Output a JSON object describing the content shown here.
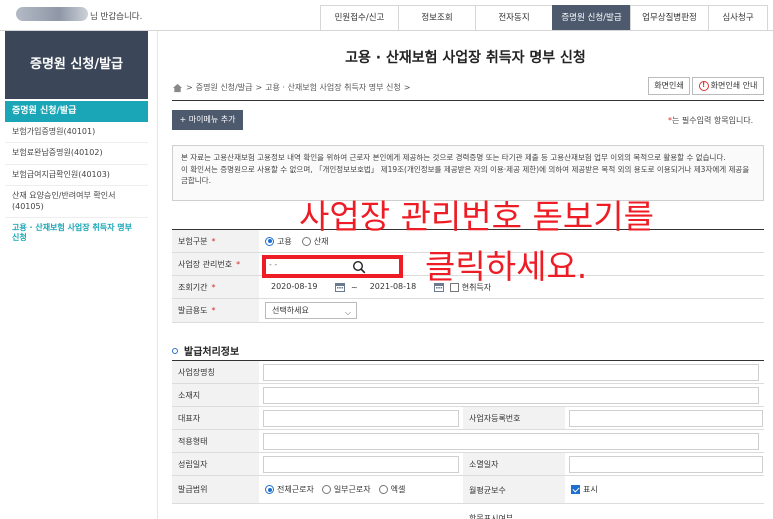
{
  "header": {
    "greeting": "님 반갑습니다.",
    "nav": [
      {
        "label": "민원접수/신고",
        "active": false
      },
      {
        "label": "정보조회",
        "active": false
      },
      {
        "label": "전자동지",
        "active": false
      },
      {
        "label": "증명원 신청/발급",
        "active": true
      },
      {
        "label": "업무상질병판정",
        "active": false
      },
      {
        "label": "심사청구",
        "active": false
      }
    ]
  },
  "sidebar": {
    "title": "증명원 신청/발급",
    "section": "증명원 신청/발급",
    "items": [
      {
        "label": "보험가입증명원(40101)"
      },
      {
        "label": "보험료완납증명원(40102)"
      },
      {
        "label": "보험급여지급확인원(40103)"
      },
      {
        "label": "산재 요양승인/반려여부 확인서(40105)"
      },
      {
        "label": "고용 · 산재보험 사업장 취득자 명부 신청"
      }
    ]
  },
  "main": {
    "title": "고용 · 산재보험 사업장 취득자 명부 신청",
    "breadcrumb": [
      "증명원 신청/발급",
      "고용 · 산재보험 사업장 취득자 명부 신청"
    ],
    "print_label": "화면인쇄",
    "guide_label": "화면인쇄 안내",
    "mymenu_label": "+ 마이메뉴 추가",
    "required_note": "는 필수입력 항목입니다.",
    "notice_line1": "본 자료는 고용산재보험 고용정보 내역 확인을 위하여 근로자 본인에게 제공하는 것으로 경력증명 또는 타기관 제출 등 고용산재보험 업무 이외의 목적으로 활용할 수 없습니다.",
    "notice_line2": "이 확인서는 증명원으로 사용할 수 없으며, 「개인정보보호법」 제19조(개인정보를 제공받은 자의 이용·제공 제한)에 의하여 제공받은 목적 외의 용도로 이용되거나 제3자에게 제공을 금합니다."
  },
  "form": {
    "insurance_type_label": "보험구분",
    "insurance_options": [
      {
        "label": "고용",
        "selected": true
      },
      {
        "label": "산재",
        "selected": false
      }
    ],
    "biz_no_label": "사업장 관리번호",
    "biz_no_value": "- -",
    "period_label": "조회기간",
    "period_from": "2020-08-19",
    "period_to": "2021-08-18",
    "period_sep": "~",
    "current_worker_label": "현취득자",
    "purpose_label": "발급용도",
    "purpose_value": "선택하세요"
  },
  "annotation": {
    "line1": "사업장 관리번호 돋보기를",
    "line2": "클릭하세요."
  },
  "issue_info": {
    "title": "발급처리정보",
    "biz_name_label": "사업장명칭",
    "address_label": "소재지",
    "ceo_label": "대표자",
    "reg_no_label": "사업자등록번호",
    "apply_type_label": "적용형태",
    "est_date_label": "성립일자",
    "close_date_label": "소멸일자",
    "scope_label": "발급범위",
    "scope_options": [
      {
        "label": "전체근로자",
        "selected": true
      },
      {
        "label": "일부근로자",
        "selected": false
      },
      {
        "label": "엑셀",
        "selected": false
      }
    ],
    "avg_wage_label_1": "월평균보수",
    "avg_wage_label_2": "항목표시여부",
    "avg_wage_value": "표시"
  },
  "colors": {
    "nav_active": "#4d5a6e",
    "sidebar_head": "#3b4658",
    "sidebar_accent": "#1aa6b6",
    "annotation_red": "#ee1c25"
  }
}
